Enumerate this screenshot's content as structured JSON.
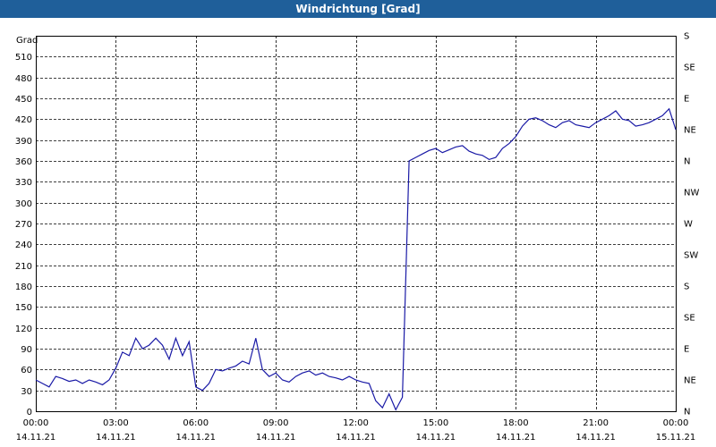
{
  "window": {
    "title": "Windrichtung [Grad]"
  },
  "chart_data": {
    "type": "line",
    "title": "Windrichtung [Grad]",
    "ylabel": "Grad",
    "ylim": [
      0,
      540
    ],
    "yticks": [
      0,
      30,
      60,
      90,
      120,
      150,
      180,
      210,
      240,
      270,
      300,
      330,
      360,
      390,
      420,
      450,
      480,
      510
    ],
    "right_axis_labels": [
      "N",
      "NE",
      "E",
      "SE",
      "S",
      "SW",
      "W",
      "NW",
      "N",
      "NE",
      "E",
      "SE",
      "S"
    ],
    "xticks": [
      {
        "time": "00:00",
        "date": "14.11.21"
      },
      {
        "time": "03:00",
        "date": "14.11.21"
      },
      {
        "time": "06:00",
        "date": "14.11.21"
      },
      {
        "time": "09:00",
        "date": "14.11.21"
      },
      {
        "time": "12:00",
        "date": "14.11.21"
      },
      {
        "time": "15:00",
        "date": "14.11.21"
      },
      {
        "time": "18:00",
        "date": "14.11.21"
      },
      {
        "time": "21:00",
        "date": "14.11.21"
      },
      {
        "time": "00:00",
        "date": "15.11.21"
      }
    ],
    "xlim_hours": [
      0,
      24
    ],
    "grid": true,
    "line_color": "#1a1aa6",
    "series": [
      {
        "x": [
          0,
          0.25,
          0.5,
          0.75,
          1,
          1.25,
          1.5,
          1.75,
          2,
          2.25,
          2.5,
          2.75,
          3,
          3.25,
          3.5,
          3.75,
          4,
          4.25,
          4.5,
          4.75,
          5,
          5.25,
          5.5,
          5.75,
          6,
          6.25,
          6.5,
          6.75,
          7,
          7.25,
          7.5,
          7.75,
          8,
          8.25,
          8.5,
          8.75,
          9,
          9.25,
          9.5,
          9.75,
          10,
          10.25,
          10.5,
          10.75,
          11,
          11.25,
          11.5,
          11.75,
          12,
          12.25,
          12.5,
          12.75,
          13,
          13.25,
          13.5,
          13.75,
          14,
          14.25,
          14.5,
          14.75,
          15,
          15.25,
          15.5,
          15.75,
          16,
          16.25,
          16.5,
          16.75,
          17,
          17.25,
          17.5,
          17.75,
          18,
          18.25,
          18.5,
          18.75,
          19,
          19.25,
          19.5,
          19.75,
          20,
          20.25,
          20.5,
          20.75,
          21,
          21.25,
          21.5,
          21.75,
          22,
          22.25,
          22.5,
          22.75,
          23,
          23.25,
          23.5,
          23.75,
          24
        ],
        "y": [
          45,
          40,
          35,
          50,
          47,
          43,
          45,
          40,
          45,
          42,
          38,
          45,
          62,
          85,
          80,
          105,
          90,
          95,
          105,
          95,
          75,
          105,
          80,
          100,
          35,
          30,
          40,
          60,
          58,
          62,
          65,
          72,
          68,
          105,
          60,
          50,
          55,
          45,
          42,
          50,
          55,
          58,
          52,
          55,
          50,
          48,
          45,
          50,
          45,
          42,
          40,
          15,
          5,
          25,
          2,
          20,
          360,
          365,
          370,
          375,
          378,
          372,
          376,
          380,
          382,
          374,
          370,
          368,
          362,
          365,
          378,
          385,
          395,
          410,
          420,
          422,
          418,
          412,
          408,
          415,
          418,
          412,
          410,
          408,
          415,
          420,
          425,
          432,
          420,
          418,
          410,
          412,
          415,
          420,
          425,
          435,
          405
        ]
      }
    ]
  }
}
